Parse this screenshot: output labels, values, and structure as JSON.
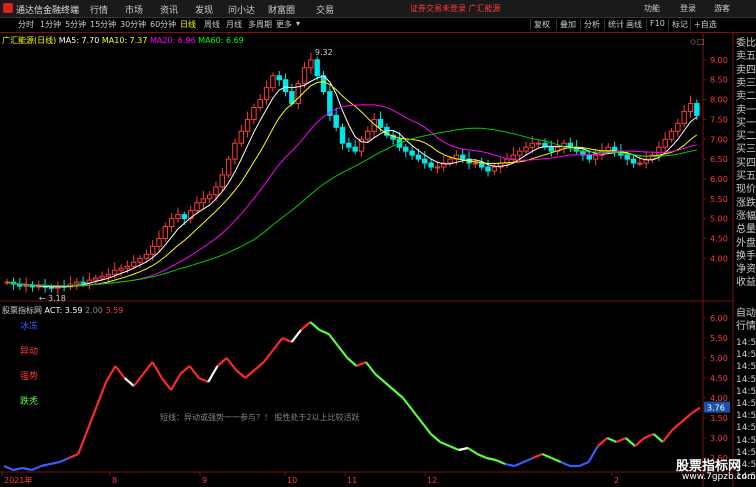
{
  "app": {
    "title": "通达信金融终端",
    "menu": [
      "行情",
      "市场",
      "资讯",
      "发现",
      "问小达",
      "财富圈",
      "交易"
    ],
    "notice": "证券交易未登录  广汇能源",
    "top_right": [
      "功能",
      "登录",
      "游客"
    ]
  },
  "toolbar": {
    "periods": [
      "分时",
      "1分钟",
      "5分钟",
      "15分钟",
      "30分钟",
      "60分钟",
      "日线",
      "周线",
      "月线",
      "多周期",
      "更多"
    ],
    "active_period": "日线",
    "right_buttons": [
      "复权",
      "叠加",
      "分析",
      "统计",
      "画线",
      "F10",
      "标记",
      "+自选"
    ]
  },
  "main_chart": {
    "stock_label": "广汇能源(日线)",
    "ma": [
      {
        "label": "MA5: 7.70",
        "color": "#ffffff"
      },
      {
        "label": "MA10: 7.37",
        "color": "#ffff00"
      },
      {
        "label": "MA20: 6.96",
        "color": "#ff00ff"
      },
      {
        "label": "MA60: 6.69",
        "color": "#00ff00"
      }
    ],
    "price_ticks": [
      "9.00",
      "8.50",
      "8.00",
      "7.50",
      "7.00",
      "6.50",
      "6.00",
      "5.50",
      "5.00",
      "4.50",
      "4.00"
    ],
    "high_label": "9.32",
    "low_label": "3.18"
  },
  "indicator": {
    "name": "股票指标网",
    "act_label": "ACT: 3.59",
    "val2": "2.00",
    "val3": "3.59",
    "ticks": [
      "6.00",
      "5.50",
      "5.00",
      "4.50",
      "4.00",
      "3.50",
      "3.00",
      "2.50"
    ],
    "current_value": "3.76",
    "legend": [
      {
        "label": "冰冻",
        "color": "#3b5bff"
      },
      {
        "label": "异动",
        "color": "#ff3b3b"
      },
      {
        "label": "强势",
        "color": "#ff3b3b"
      },
      {
        "label": "跌秃",
        "color": "#5aff3b"
      }
    ],
    "annotation": "短线：异动或强势一一参与？！ 股性处于2以上比较活跃"
  },
  "time_axis": [
    "2021年",
    "8",
    "9",
    "10",
    "11",
    "12",
    "2"
  ],
  "side_panel": {
    "quote": [
      "委比",
      "卖五",
      "卖四",
      "卖三",
      "卖二",
      "卖一",
      "买一",
      "买二",
      "买三",
      "买四",
      "买五",
      "现价",
      "涨跌",
      "涨幅",
      "总量",
      "外盘",
      "换手",
      "净资",
      "收益"
    ],
    "auto": [
      "自动",
      "行情"
    ],
    "times": [
      "14:5",
      "14:5",
      "14:5",
      "14:5",
      "14:5",
      "14:5",
      "14:5",
      "14:5",
      "14:5",
      "14:5",
      "14:5",
      "14:5"
    ]
  },
  "watermark": {
    "title": "股票指标网",
    "url": "www.7gpzb.com"
  },
  "chart_data": {
    "type": "candlestick",
    "price_range": [
      3.0,
      9.4
    ],
    "closes": [
      3.4,
      3.35,
      3.3,
      3.32,
      3.28,
      3.3,
      3.27,
      3.25,
      3.3,
      3.28,
      3.35,
      3.4,
      3.38,
      3.45,
      3.5,
      3.55,
      3.6,
      3.7,
      3.75,
      3.8,
      3.9,
      4.0,
      4.1,
      4.3,
      4.5,
      4.8,
      5.0,
      5.1,
      5.0,
      5.2,
      5.4,
      5.5,
      5.6,
      5.8,
      6.1,
      6.5,
      6.9,
      7.2,
      7.5,
      7.8,
      8.0,
      8.3,
      8.6,
      8.5,
      8.2,
      7.9,
      8.4,
      8.8,
      9.0,
      8.6,
      8.2,
      7.6,
      7.3,
      6.9,
      6.8,
      6.7,
      7.0,
      7.2,
      7.5,
      7.3,
      7.1,
      7.0,
      6.8,
      6.7,
      6.6,
      6.5,
      6.4,
      6.3,
      6.3,
      6.4,
      6.5,
      6.6,
      6.5,
      6.4,
      6.4,
      6.3,
      6.2,
      6.3,
      6.4,
      6.5,
      6.6,
      6.7,
      6.8,
      6.9,
      6.9,
      6.8,
      6.7,
      6.8,
      6.9,
      6.8,
      6.7,
      6.6,
      6.5,
      6.6,
      6.7,
      6.8,
      6.7,
      6.6,
      6.5,
      6.4,
      6.4,
      6.5,
      6.6,
      6.8,
      7.0,
      7.2,
      7.4,
      7.7,
      7.9,
      7.6
    ],
    "act": [
      2.3,
      2.2,
      2.25,
      2.2,
      2.3,
      2.35,
      2.4,
      2.5,
      2.6,
      3.2,
      3.8,
      4.4,
      4.8,
      4.5,
      4.3,
      4.6,
      4.9,
      4.5,
      4.2,
      4.6,
      4.8,
      4.5,
      4.4,
      4.8,
      5.0,
      4.7,
      4.5,
      4.7,
      4.9,
      5.2,
      5.5,
      5.4,
      5.7,
      5.9,
      5.7,
      5.6,
      5.3,
      5.0,
      4.8,
      4.9,
      4.6,
      4.4,
      4.2,
      4.0,
      3.7,
      3.4,
      3.1,
      2.9,
      2.8,
      2.7,
      2.75,
      2.6,
      2.5,
      2.45,
      2.35,
      2.3,
      2.4,
      2.5,
      2.6,
      2.5,
      2.4,
      2.3,
      2.3,
      2.4,
      2.8,
      3.0,
      2.9,
      3.0,
      2.8,
      3.0,
      3.1,
      2.9,
      3.2,
      3.4,
      3.6,
      3.76
    ]
  }
}
